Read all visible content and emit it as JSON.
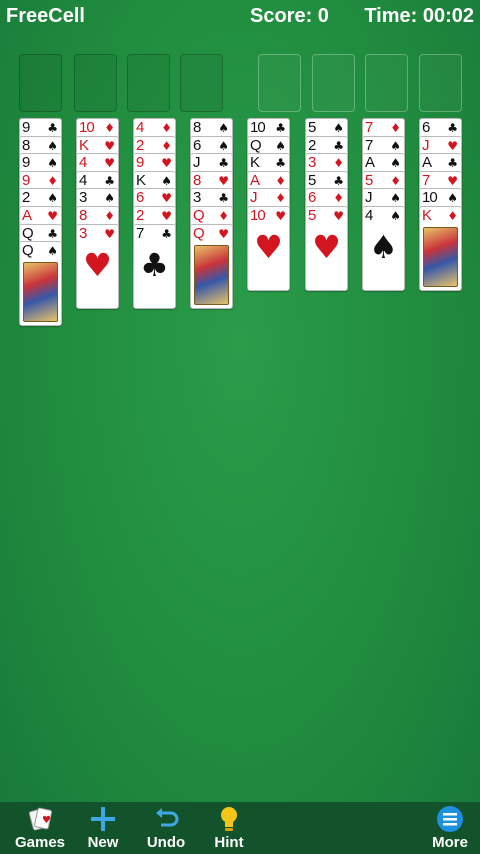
{
  "header": {
    "app_title": "FreeCell",
    "score_label": "Score: 0",
    "time_label": "Time: 00:02"
  },
  "colors": {
    "felt": "#208c3e",
    "toolbar": "#13532b",
    "red_suit": "#d2151f",
    "black_suit": "#111111"
  },
  "free_cells": [
    "",
    "",
    "",
    ""
  ],
  "foundations": [
    "",
    "",
    "",
    ""
  ],
  "columns": [
    [
      {
        "r": "9",
        "s": "clubs"
      },
      {
        "r": "8",
        "s": "spades"
      },
      {
        "r": "9",
        "s": "spades"
      },
      {
        "r": "9",
        "s": "diamonds"
      },
      {
        "r": "2",
        "s": "spades"
      },
      {
        "r": "A",
        "s": "hearts"
      },
      {
        "r": "Q",
        "s": "clubs"
      },
      {
        "r": "Q",
        "s": "spades"
      }
    ],
    [
      {
        "r": "10",
        "s": "diamonds"
      },
      {
        "r": "K",
        "s": "hearts"
      },
      {
        "r": "4",
        "s": "hearts"
      },
      {
        "r": "4",
        "s": "clubs"
      },
      {
        "r": "3",
        "s": "spades"
      },
      {
        "r": "8",
        "s": "diamonds"
      },
      {
        "r": "3",
        "s": "hearts"
      }
    ],
    [
      {
        "r": "4",
        "s": "diamonds"
      },
      {
        "r": "2",
        "s": "diamonds"
      },
      {
        "r": "9",
        "s": "hearts"
      },
      {
        "r": "K",
        "s": "spades"
      },
      {
        "r": "6",
        "s": "hearts"
      },
      {
        "r": "2",
        "s": "hearts"
      },
      {
        "r": "7",
        "s": "clubs"
      }
    ],
    [
      {
        "r": "8",
        "s": "spades"
      },
      {
        "r": "6",
        "s": "spades"
      },
      {
        "r": "J",
        "s": "clubs"
      },
      {
        "r": "8",
        "s": "hearts"
      },
      {
        "r": "3",
        "s": "clubs"
      },
      {
        "r": "Q",
        "s": "diamonds"
      },
      {
        "r": "Q",
        "s": "hearts"
      }
    ],
    [
      {
        "r": "10",
        "s": "clubs"
      },
      {
        "r": "Q",
        "s": "spades"
      },
      {
        "r": "K",
        "s": "clubs"
      },
      {
        "r": "A",
        "s": "diamonds"
      },
      {
        "r": "J",
        "s": "diamonds"
      },
      {
        "r": "10",
        "s": "hearts"
      }
    ],
    [
      {
        "r": "5",
        "s": "spades"
      },
      {
        "r": "2",
        "s": "clubs"
      },
      {
        "r": "3",
        "s": "diamonds"
      },
      {
        "r": "5",
        "s": "clubs"
      },
      {
        "r": "6",
        "s": "diamonds"
      },
      {
        "r": "5",
        "s": "hearts"
      }
    ],
    [
      {
        "r": "7",
        "s": "diamonds"
      },
      {
        "r": "7",
        "s": "spades"
      },
      {
        "r": "A",
        "s": "spades"
      },
      {
        "r": "5",
        "s": "diamonds"
      },
      {
        "r": "J",
        "s": "spades"
      },
      {
        "r": "4",
        "s": "spades"
      }
    ],
    [
      {
        "r": "6",
        "s": "clubs"
      },
      {
        "r": "J",
        "s": "hearts"
      },
      {
        "r": "A",
        "s": "clubs"
      },
      {
        "r": "7",
        "s": "hearts"
      },
      {
        "r": "10",
        "s": "spades"
      },
      {
        "r": "K",
        "s": "diamonds"
      }
    ]
  ],
  "toolbar": {
    "games_label": "Games",
    "new_label": "New",
    "undo_label": "Undo",
    "hint_label": "Hint",
    "more_label": "More"
  }
}
